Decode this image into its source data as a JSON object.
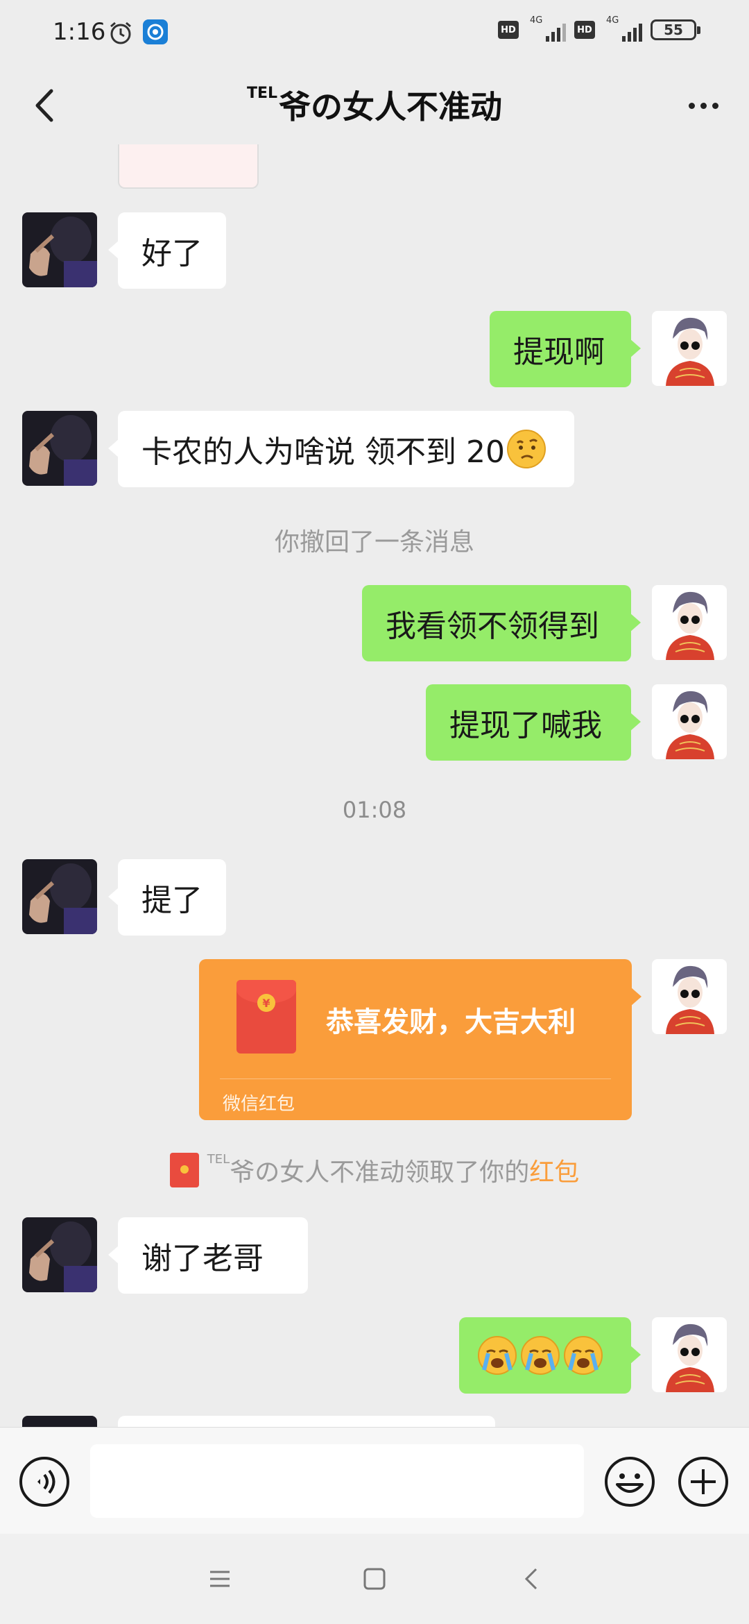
{
  "status_bar": {
    "time": "1:16",
    "network_1": "4G",
    "network_2": "4G",
    "hd_1": "HD",
    "hd_2": "HD",
    "battery": "55",
    "alarm_icon": "alarm-clock-icon",
    "app_icon": "app-notification-icon"
  },
  "header": {
    "title_prefix": "TEL",
    "title": "爷の女人不准动",
    "back_icon": "chevron-left-icon",
    "more_icon": "more-dots-icon"
  },
  "messages": [
    {
      "side": "left",
      "text": "好了"
    },
    {
      "side": "right",
      "text": "提现啊"
    },
    {
      "side": "left",
      "text": "卡农的人为啥说 领不到 20",
      "emoji": "confused-face"
    },
    {
      "side": "system",
      "text": "你撤回了一条消息"
    },
    {
      "side": "right",
      "text": "我看领不领得到"
    },
    {
      "side": "right",
      "text": "提现了喊我"
    },
    {
      "side": "time",
      "text": "01:08"
    },
    {
      "side": "left",
      "text": "提了"
    },
    {
      "side": "right",
      "type": "red_packet",
      "text": "恭喜发财，大吉大利",
      "label": "微信红包"
    },
    {
      "side": "system",
      "type": "red_packet_notice",
      "prefix": "TEL",
      "text": "爷の女人不准动领取了你的",
      "link": "红包"
    },
    {
      "side": "left",
      "text": "谢了老哥"
    },
    {
      "side": "right",
      "emoji": "loudly-crying-face",
      "emoji_count": 3
    }
  ],
  "input_bar": {
    "voice_icon": "voice-input-icon",
    "emoji_icon": "emoji-smile-icon",
    "plus_icon": "plus-circle-icon",
    "placeholder": ""
  },
  "colors": {
    "background": "#ededed",
    "self_bubble": "#95ec69",
    "other_bubble": "#ffffff",
    "red_packet": "#fa9d3b",
    "link": "#fa9d3b"
  }
}
